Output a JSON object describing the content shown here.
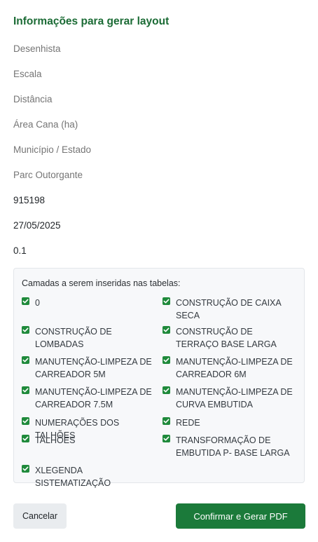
{
  "form": {
    "title": "Informações para gerar layout",
    "fields": {
      "desenhista": {
        "placeholder": "Desenhista",
        "value": ""
      },
      "escala": {
        "placeholder": "Escala",
        "value": ""
      },
      "distancia": {
        "placeholder": "Distância",
        "value": ""
      },
      "area_cana": {
        "placeholder": "Área Cana (ha)",
        "value": ""
      },
      "municipio_estado": {
        "placeholder": "Município / Estado",
        "value": ""
      },
      "parc_outorgante": {
        "placeholder": "Parc Outorgante",
        "value": ""
      },
      "field_7": {
        "value": "915198"
      },
      "field_8": {
        "value": "27/05/2025"
      },
      "field_9": {
        "value": "0.1"
      }
    }
  },
  "layers": {
    "title": "Camadas a serem inseridas nas tabelas:",
    "items": [
      {
        "label": "0",
        "checked": true
      },
      {
        "label": "CONSTRUÇÃO DE CAIXA SECA",
        "checked": true
      },
      {
        "label": "CONSTRUÇÃO DE LOMBADAS",
        "checked": true
      },
      {
        "label": "CONSTRUÇÃO DE TERRAÇO BASE LARGA",
        "checked": true
      },
      {
        "label": "MANUTENÇÃO-LIMPEZA DE CARREADOR 5M",
        "checked": true
      },
      {
        "label": "MANUTENÇÃO-LIMPEZA DE CARREADOR 6M",
        "checked": true
      },
      {
        "label": "MANUTENÇÃO-LIMPEZA DE CARREADOR 7.5M",
        "checked": true
      },
      {
        "label": "MANUTENÇÃO-LIMPEZA DE CURVA EMBUTIDA",
        "checked": true
      },
      {
        "label": "NUMERAÇÕES DOS TALHÕES",
        "checked": true
      },
      {
        "label": "REDE",
        "checked": true
      },
      {
        "label": "TALHÕES",
        "checked": true
      },
      {
        "label": "TRANSFORMAÇÃO DE EMBUTIDA P- BASE LARGA",
        "checked": true
      },
      {
        "label": "XLEGENDA SISTEMATIZAÇÃO",
        "checked": true
      }
    ]
  },
  "actions": {
    "cancel_label": "Cancelar",
    "confirm_label": "Confirmar e Gerar PDF"
  },
  "colors": {
    "title": "#1b6b35",
    "checkbox": "#1f8a3b",
    "confirm_button": "#1b7a3a",
    "cancel_button": "#e9ecef"
  }
}
